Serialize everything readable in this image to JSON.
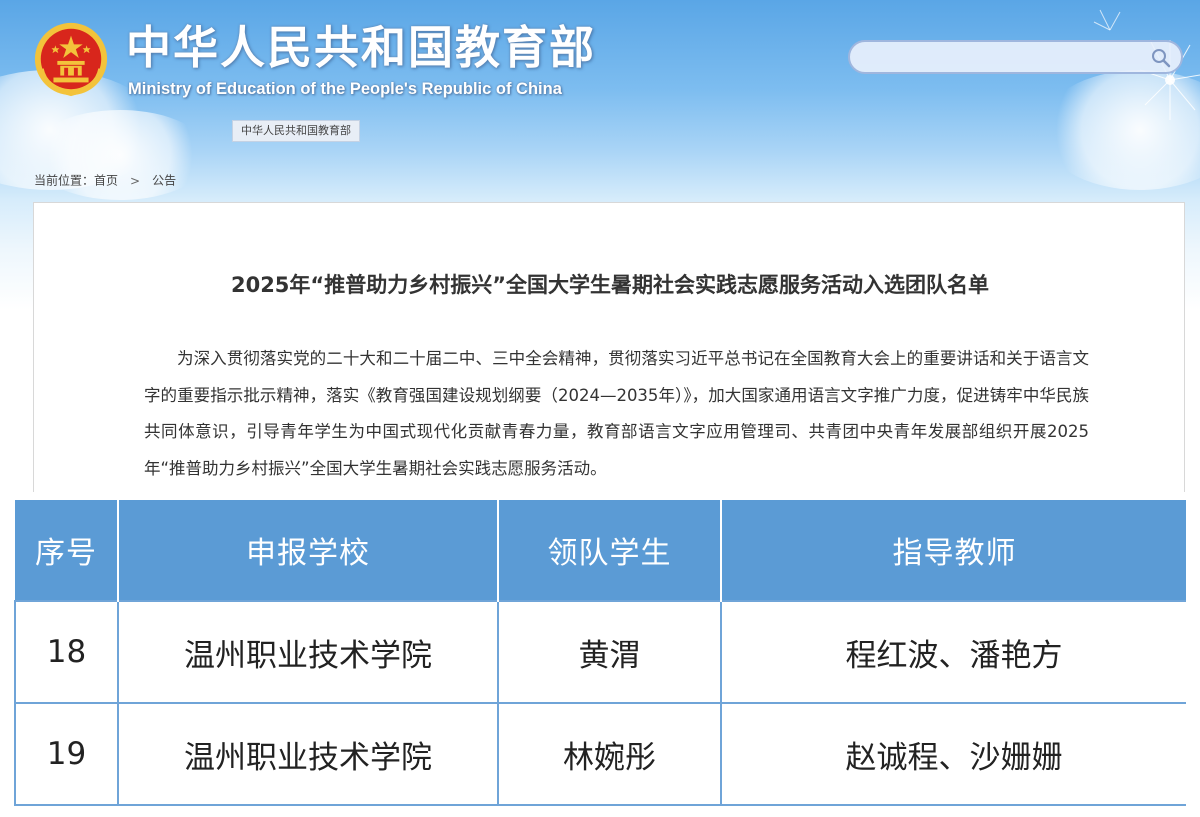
{
  "header": {
    "title": "中华人民共和国教育部",
    "subtitle": "Ministry of Education of the People's Republic of China",
    "tag": "中华人民共和国教育部",
    "search": {
      "placeholder": "",
      "icon": "search-icon"
    }
  },
  "breadcrumb": {
    "label": "当前位置：",
    "home": "首页",
    "separator": ">",
    "current": "公告"
  },
  "article": {
    "title": "2025年“推普助力乡村振兴”全国大学生暑期社会实践志愿服务活动入选团队名单",
    "body": "为深入贯彻落实党的二十大和二十届二中、三中全会精神，贯彻落实习近平总书记在全国教育大会上的重要讲话和关于语言文字的重要指示批示精神，落实《教育强国建设规划纲要（2024—2035年）》，加大国家通用语言文字推广力度，促进铸牢中华民族共同体意识，引导青年学生为中国式现代化贡献青春力量，教育部语言文字应用管理司、共青团中央青年发展部组织开展2025年“推普助力乡村振兴”全国大学生暑期社会实践志愿服务活动。"
  },
  "table": {
    "headers": [
      "序号",
      "申报学校",
      "领队学生",
      "指导教师"
    ],
    "rows": [
      [
        "18",
        "温州职业技术学院",
        "黄渭",
        "程红波、潘艳方"
      ],
      [
        "19",
        "温州职业技术学院",
        "林婉彤",
        "赵诚程、沙姗姗"
      ]
    ]
  },
  "colors": {
    "header_sky": "#5aa6e6",
    "table_header": "#5b9bd5",
    "table_border": "#6fa4d8",
    "emblem_red": "#d8261c",
    "emblem_gold": "#f3c33b"
  }
}
